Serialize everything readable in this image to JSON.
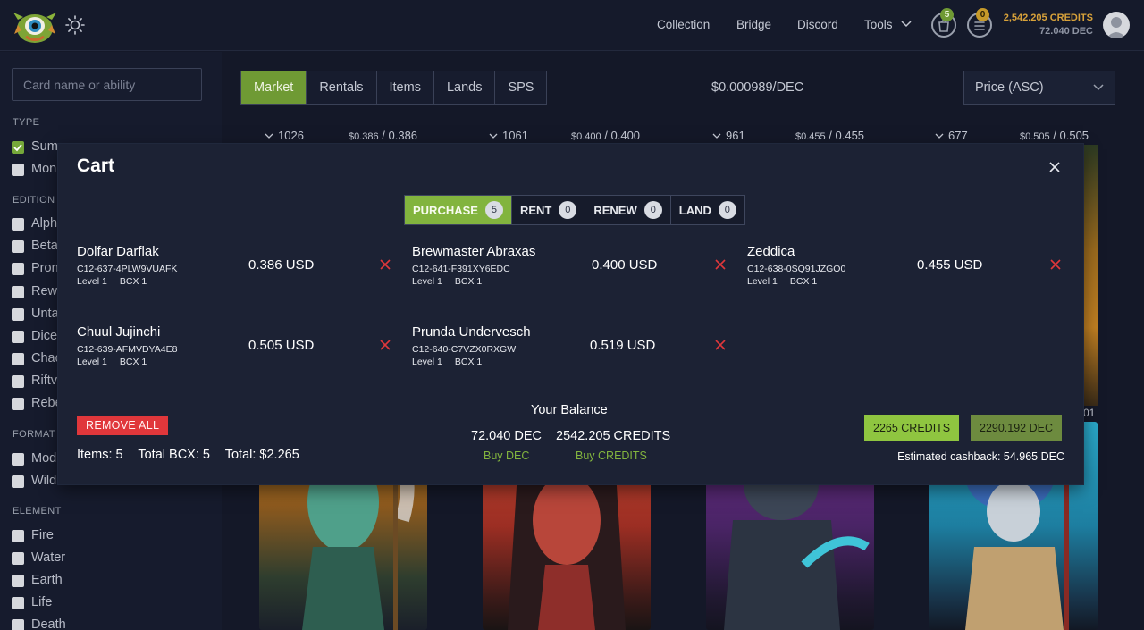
{
  "header": {
    "nav": [
      "Collection",
      "Bridge",
      "Discord",
      "Tools"
    ],
    "cart_count": "5",
    "notif_count": "0",
    "credits": "2,542.205 CREDITS",
    "dec": "72.040 DEC",
    "icons": [
      "monster-logo-icon",
      "sun-icon",
      "cart-icon",
      "notification-icon",
      "avatar"
    ]
  },
  "sidebar": {
    "search_placeholder": "Card name or ability",
    "type_title": "TYPE",
    "type_items": [
      "Sum",
      "Mon"
    ],
    "edition_title": "EDITION",
    "edition_items": [
      "Alph",
      "Beta",
      "Pron",
      "Rew",
      "Unta",
      "Dice",
      "Chac",
      "Riftv",
      "Rebe"
    ],
    "format_title": "FORMAT",
    "format_items": [
      "Mod",
      "Wild"
    ],
    "element_title": "ELEMENT",
    "element_items": [
      "Fire",
      "Water",
      "Earth",
      "Life",
      "Death"
    ]
  },
  "main": {
    "tabs": [
      "Market",
      "Rentals",
      "Items",
      "Lands",
      "SPS"
    ],
    "price_rate": "$0.000989/DEC",
    "sort": "Price (ASC)",
    "columns": [
      {
        "count": "1026",
        "usd": "$0.386",
        "dec": "0.386"
      },
      {
        "count": "1061",
        "usd": "$0.400",
        "dec": "0.400"
      },
      {
        "count": "961",
        "usd": "$0.455",
        "dec": "0.455"
      },
      {
        "count": "677",
        "usd": "$0.505",
        "dec": "0.505"
      }
    ],
    "partial_label": "01"
  },
  "modal": {
    "title": "Cart",
    "segments": [
      {
        "label": "PURCHASE",
        "count": "5"
      },
      {
        "label": "RENT",
        "count": "0"
      },
      {
        "label": "RENEW",
        "count": "0"
      },
      {
        "label": "LAND",
        "count": "0"
      }
    ],
    "items": [
      {
        "name": "Dolfar Darflak",
        "id": "C12-637-4PLW9VUAFK",
        "level": "Level 1",
        "bcx": "BCX 1",
        "price": "0.386 USD"
      },
      {
        "name": "Brewmaster Abraxas",
        "id": "C12-641-F391XY6EDC",
        "level": "Level 1",
        "bcx": "BCX 1",
        "price": "0.400 USD"
      },
      {
        "name": "Zeddica",
        "id": "C12-638-0SQ91JZGO0",
        "level": "Level 1",
        "bcx": "BCX 1",
        "price": "0.455 USD"
      },
      {
        "name": "Chuul Jujinchi",
        "id": "C12-639-AFMVDYA4E8",
        "level": "Level 1",
        "bcx": "BCX 1",
        "price": "0.505 USD"
      },
      {
        "name": "Prunda Undervesch",
        "id": "C12-640-C7VZX0RXGW",
        "level": "Level 1",
        "bcx": "BCX 1",
        "price": "0.519 USD"
      }
    ],
    "remove_all": "REMOVE ALL",
    "items_label": "Items: 5",
    "total_bcx": "Total BCX: 5",
    "total": "Total: $2.265",
    "your_balance": "Your Balance",
    "balance_dec": "72.040 DEC",
    "balance_credits": "2542.205 CREDITS",
    "buy_dec": "Buy DEC",
    "buy_credits": "Buy CREDITS",
    "pay_credits": "2265 CREDITS",
    "pay_dec": "2290.192 DEC",
    "cashback": "Estimated cashback: 54.965 DEC"
  },
  "colors": {
    "accent_green": "#82b43e",
    "remove_red": "#e0373b",
    "credits_gold": "#d8a23a"
  }
}
